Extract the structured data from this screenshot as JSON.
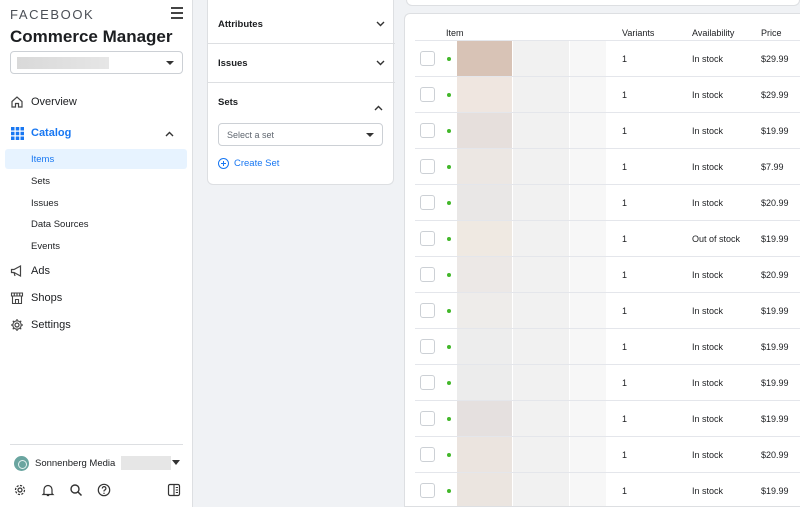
{
  "brand": "FACEBOOK",
  "app_title": "Commerce Manager",
  "sidebar": {
    "items": [
      {
        "label": "Overview",
        "icon": "home-icon"
      },
      {
        "label": "Catalog",
        "icon": "grid-icon",
        "expanded": true
      },
      {
        "label": "Ads",
        "icon": "megaphone-icon"
      },
      {
        "label": "Shops",
        "icon": "storefront-icon"
      },
      {
        "label": "Settings",
        "icon": "gear-icon"
      }
    ],
    "catalog_sub": [
      {
        "label": "Items",
        "selected": true
      },
      {
        "label": "Sets"
      },
      {
        "label": "Issues"
      },
      {
        "label": "Data Sources"
      },
      {
        "label": "Events"
      }
    ],
    "business_name": "Sonnenberg Media"
  },
  "filters": {
    "attributes": "Attributes",
    "issues": "Issues",
    "sets": "Sets",
    "set_select_placeholder": "Select a set",
    "create_set": "Create Set"
  },
  "table": {
    "columns": {
      "item": "Item",
      "variants": "Variants",
      "availability": "Availability",
      "price": "Price"
    },
    "rows": [
      {
        "variants": "1",
        "availability": "In stock",
        "price": "$29.99"
      },
      {
        "variants": "1",
        "availability": "In stock",
        "price": "$29.99"
      },
      {
        "variants": "1",
        "availability": "In stock",
        "price": "$19.99"
      },
      {
        "variants": "1",
        "availability": "In stock",
        "price": "$7.99"
      },
      {
        "variants": "1",
        "availability": "In stock",
        "price": "$20.99"
      },
      {
        "variants": "1",
        "availability": "Out of stock",
        "price": "$19.99"
      },
      {
        "variants": "1",
        "availability": "In stock",
        "price": "$20.99"
      },
      {
        "variants": "1",
        "availability": "In stock",
        "price": "$19.99"
      },
      {
        "variants": "1",
        "availability": "In stock",
        "price": "$19.99"
      },
      {
        "variants": "1",
        "availability": "In stock",
        "price": "$19.99"
      },
      {
        "variants": "1",
        "availability": "In stock",
        "price": "$19.99"
      },
      {
        "variants": "1",
        "availability": "In stock",
        "price": "$20.99"
      },
      {
        "variants": "1",
        "availability": "In stock",
        "price": "$19.99"
      }
    ]
  },
  "colors": {
    "accent": "#1877f2",
    "status_dot": "#42b72a",
    "selected_bg": "#e7f3ff"
  }
}
